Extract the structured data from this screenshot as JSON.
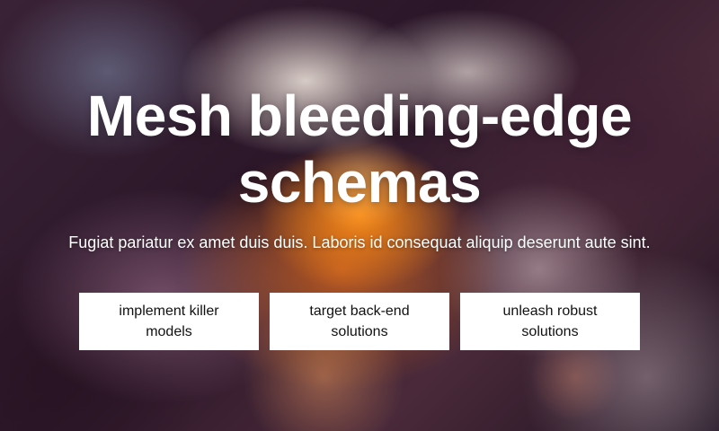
{
  "hero": {
    "title_line1": "Mesh bleeding-edge",
    "title_line2": "schemas",
    "subtitle": "Fugiat pariatur ex amet duis duis. Laboris id consequat aliquip deserunt aute sint.",
    "buttons": [
      {
        "label": "implement killer models"
      },
      {
        "label": "target back-end solutions"
      },
      {
        "label": "unleash robust solutions"
      }
    ]
  },
  "colors": {
    "text": "#ffffff",
    "button_bg": "#ffffff",
    "button_text": "#111111",
    "accent_orange": "#ff8c14"
  }
}
